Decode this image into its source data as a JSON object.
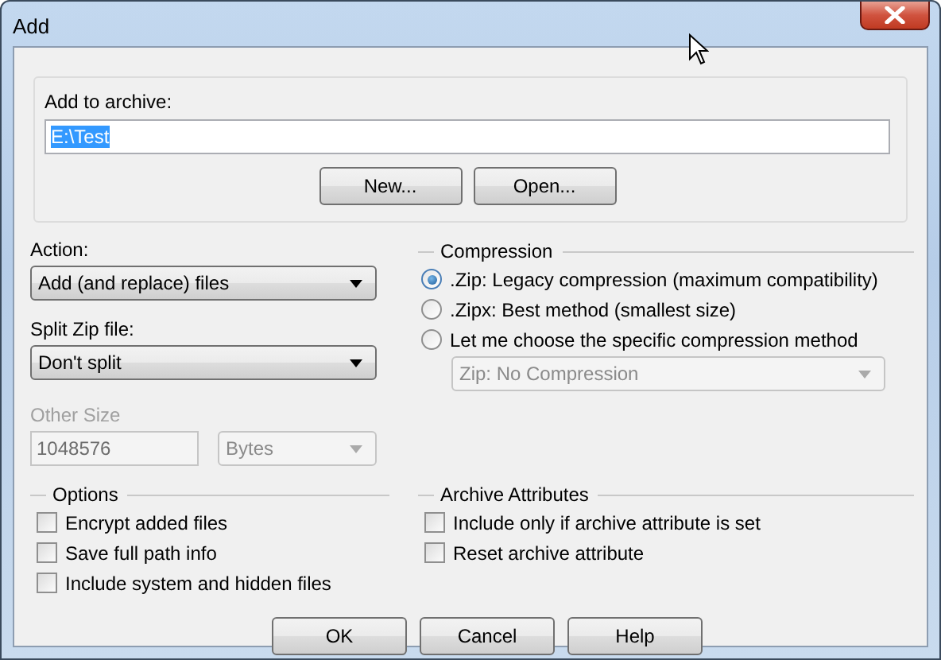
{
  "window": {
    "title": "Add"
  },
  "archive": {
    "label": "Add to archive:",
    "value": "E:\\Test",
    "selected": true,
    "buttons": [
      "New...",
      "Open..."
    ]
  },
  "action": {
    "label": "Action:",
    "value": "Add (and replace) files"
  },
  "split": {
    "label": "Split Zip file:",
    "value": "Don't split"
  },
  "other_size": {
    "label": "Other Size",
    "value": "1048576",
    "unit": "Bytes",
    "disabled": true
  },
  "compression": {
    "title": "Compression",
    "options": [
      {
        "label": ".Zip: Legacy compression (maximum compatibility)",
        "selected": true
      },
      {
        "label": ".Zipx: Best method (smallest size)",
        "selected": false
      },
      {
        "label": "Let me choose the specific compression method",
        "selected": false
      }
    ],
    "method": {
      "value": "Zip: No Compression",
      "disabled": true
    }
  },
  "options": {
    "title": "Options",
    "items": [
      {
        "label": "Encrypt added files",
        "checked": false
      },
      {
        "label": "Save full path info",
        "checked": false
      },
      {
        "label": "Include system and hidden files",
        "checked": false
      }
    ]
  },
  "archive_attributes": {
    "title": "Archive Attributes",
    "items": [
      {
        "label": "Include only if archive attribute is set",
        "checked": false
      },
      {
        "label": "Reset archive attribute",
        "checked": false
      }
    ]
  },
  "buttons": [
    "OK",
    "Cancel",
    "Help"
  ]
}
